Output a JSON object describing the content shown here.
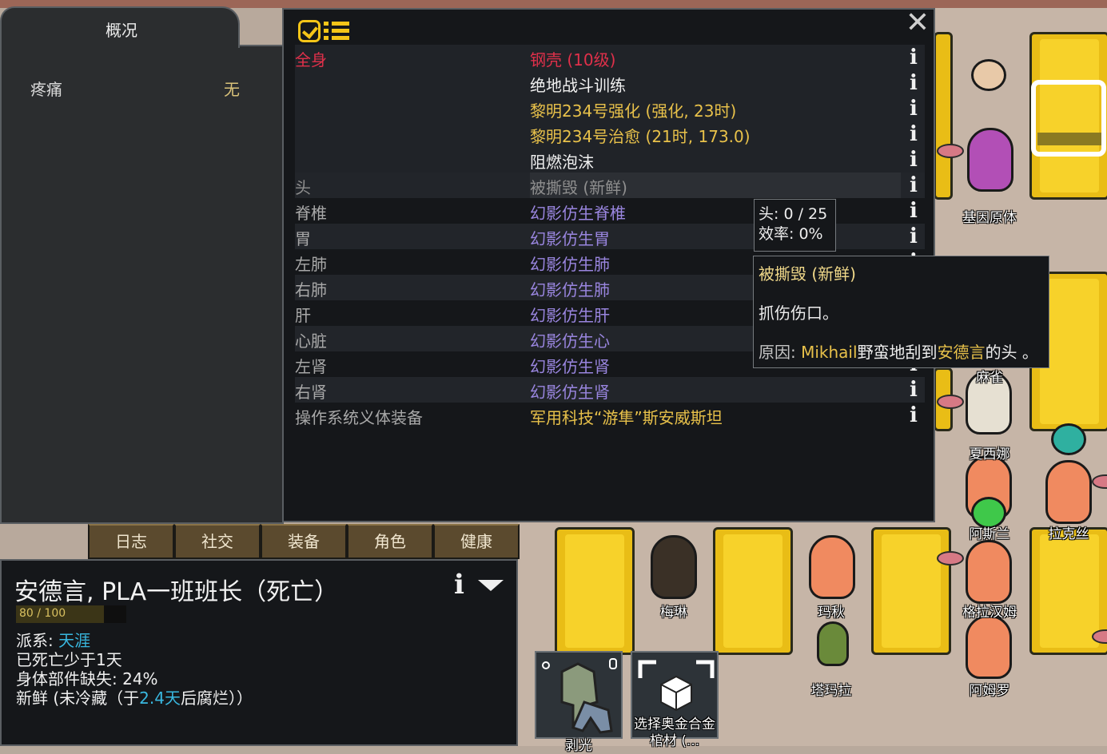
{
  "overview": {
    "tab_label": "概况",
    "pain_label": "疼痛",
    "pain_value": "无"
  },
  "health": {
    "rows": [
      {
        "part": "全身",
        "condition": "钢壳 (10级)",
        "part_color": "#e0304a",
        "cond_color": "#e0304a"
      },
      {
        "part": "",
        "condition": "绝地战斗训练",
        "cond_color": "#f0f0f0"
      },
      {
        "part": "",
        "condition": "黎明234号强化 (强化, 23时)",
        "cond_color": "#e8c14a"
      },
      {
        "part": "",
        "condition": "黎明234号治愈 (21时, 173.0)",
        "cond_color": "#e8c14a"
      },
      {
        "part": "",
        "condition": "阻燃泡沫",
        "cond_color": "#f0f0f0"
      },
      {
        "part": "头",
        "condition": "被撕毁 (新鲜)",
        "cond_color": "#8f8f8f",
        "part_color": "#8f8f8f"
      },
      {
        "part": "脊椎",
        "condition": "幻影仿生脊椎",
        "cond_color": "#9a86e0"
      },
      {
        "part": "胃",
        "condition": "幻影仿生胃",
        "cond_color": "#9a86e0"
      },
      {
        "part": "左肺",
        "condition": "幻影仿生肺",
        "cond_color": "#9a86e0"
      },
      {
        "part": "右肺",
        "condition": "幻影仿生肺",
        "cond_color": "#9a86e0"
      },
      {
        "part": "肝",
        "condition": "幻影仿生肝",
        "cond_color": "#9a86e0"
      },
      {
        "part": "心脏",
        "condition": "幻影仿生心",
        "cond_color": "#9a86e0"
      },
      {
        "part": "左肾",
        "condition": "幻影仿生肾",
        "cond_color": "#9a86e0"
      },
      {
        "part": "右肾",
        "condition": "幻影仿生肾",
        "cond_color": "#9a86e0"
      },
      {
        "part": "操作系统义体装备",
        "condition": "军用科技“游隼”斯安威斯坦",
        "cond_color": "#e8c14a"
      }
    ]
  },
  "tooltip_head": {
    "line1": "头:  0 / 25",
    "line2": "效率: 0%"
  },
  "tooltip_injury": {
    "title": "被撕毁 (新鲜)",
    "desc": "抓伤伤口。",
    "cause_label": "原因: ",
    "cause_attacker": "Mikhail",
    "cause_mid": "野蛮地刮到",
    "cause_victim": "安德言",
    "cause_end": "的头 。"
  },
  "tabs": [
    "日志",
    "社交",
    "装备",
    "角色",
    "健康"
  ],
  "inspect": {
    "name": "安德言, PLA一班班长（死亡）",
    "bar_text": "80 / 100",
    "bar_fraction": 0.8,
    "faction_label": "派系: ",
    "faction_value": "天涯",
    "dead_line": "已死亡少于1天",
    "missing_line": "身体部件缺失: 24%",
    "fresh_prefix": "新鲜 (未冷藏（于",
    "fresh_days": "2.4天",
    "fresh_suffix": "后腐烂））"
  },
  "gizmos": {
    "strip_label": "剥光",
    "select_label_1": "选择奥金合金",
    "select_label_2": "棺材 (..."
  },
  "world_labels": {
    "gene": "基因原体",
    "mq": "麻雀",
    "xxn": "夏西娜",
    "asl": "阿斯兰",
    "lks": "拉克丝",
    "ml": "梅琳",
    "mq2": "玛秋",
    "glhm": "格拉汉姆",
    "tml": "塔玛拉",
    "amr": "阿姆罗"
  }
}
